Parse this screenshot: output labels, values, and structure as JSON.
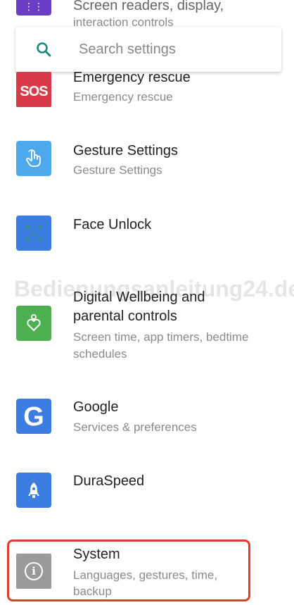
{
  "partial_item": {
    "title": "Screen readers, display,",
    "subtitle": "interaction controls"
  },
  "search": {
    "placeholder": "Search settings",
    "icon": "search-icon"
  },
  "watermark": "Bedienungsanleitung24.de",
  "items": [
    {
      "title": "Emergency rescue",
      "subtitle": "Emergency rescue",
      "icon": "sos-icon",
      "icon_label": "SOS",
      "color": "#d93a4a"
    },
    {
      "title": "Gesture Settings",
      "subtitle": "Gesture Settings",
      "icon": "hand-gesture-icon",
      "color": "#4ea8ec"
    },
    {
      "title": "Face Unlock",
      "subtitle": "",
      "icon": "face-unlock-icon",
      "color": "#3b7de0"
    },
    {
      "title_line1": "Digital Wellbeing and",
      "title_line2": "parental controls",
      "subtitle_line1": "Screen time, app timers, bedtime",
      "subtitle_line2": "schedules",
      "icon": "wellbeing-heart-icon",
      "color": "#4caf50"
    },
    {
      "title": "Google",
      "subtitle": "Services & preferences",
      "icon": "google-g-icon",
      "icon_label": "G",
      "color": "#3b7de0"
    },
    {
      "title": "DuraSpeed",
      "subtitle": "",
      "icon": "rocket-icon",
      "color": "#3b7de0"
    },
    {
      "title": "System",
      "subtitle_line1": "Languages, gestures, time,",
      "subtitle_line2": "backup",
      "icon": "info-icon",
      "icon_label": "i",
      "color": "#9a9a9a"
    }
  ],
  "highlight_color": "#e03e2d"
}
